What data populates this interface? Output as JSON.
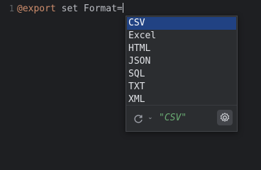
{
  "editor": {
    "line_number": "1",
    "code": {
      "keyword": "@export",
      "text": " set Format="
    }
  },
  "popup": {
    "items": [
      "CSV",
      "Excel",
      "HTML",
      "JSON",
      "SQL",
      "TXT",
      "XML"
    ],
    "selected": "CSV",
    "footer": {
      "refresh_icon": "refresh-icon",
      "chevron_icon": "chevron-down-icon",
      "chevron_glyph": "⌄",
      "preview_text": "\"CSV\"",
      "settings_icon": "gear-icon"
    }
  },
  "colors": {
    "background": "#1e1f22",
    "popup_background": "#2b2d30",
    "selection": "#214283",
    "keyword": "#cf8e6d",
    "string": "#6aab73"
  }
}
